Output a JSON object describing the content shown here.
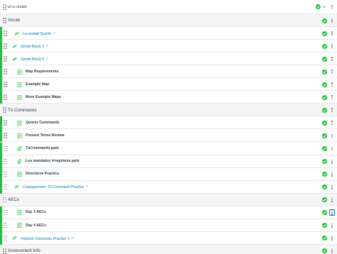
{
  "page": {
    "title": "La ciudad"
  },
  "colors": {
    "published": "#1fc338",
    "link": "#0374b5",
    "text": "#2d3b45",
    "muted": "#6b7780"
  },
  "rows": [
    {
      "kind": "header",
      "title": "Vocab"
    },
    {
      "kind": "item",
      "type": "link",
      "title": "La ciudad Quizlet",
      "external": true
    },
    {
      "kind": "item",
      "type": "link",
      "title": "Gimkit Block 2",
      "external": true
    },
    {
      "kind": "item",
      "type": "link",
      "title": "Gimkit Block 5",
      "external": true
    },
    {
      "kind": "item",
      "type": "page",
      "title": "Map Requirements",
      "external": false
    },
    {
      "kind": "item",
      "type": "page",
      "title": "Example Map",
      "external": false
    },
    {
      "kind": "item",
      "type": "page",
      "title": "More Example Maps",
      "external": false
    },
    {
      "kind": "header",
      "title": "Tú Commands"
    },
    {
      "kind": "item",
      "type": "page",
      "title": "Quizizz Commands",
      "external": false
    },
    {
      "kind": "item",
      "type": "page",
      "title": "Present Tense Review",
      "external": false
    },
    {
      "kind": "item",
      "type": "file",
      "title": "TúCommands.pptx",
      "external": false
    },
    {
      "kind": "item",
      "type": "file",
      "title": "Los mandatos irregulares.pptx",
      "external": false
    },
    {
      "kind": "item",
      "type": "page",
      "title": "Directions Practice",
      "external": false
    },
    {
      "kind": "item",
      "type": "link",
      "title": "Conjuguemos: Tú Command Practice",
      "external": true
    },
    {
      "kind": "header",
      "title": "AECs"
    },
    {
      "kind": "item",
      "type": "page",
      "title": "Day 3 AECs",
      "external": false
    },
    {
      "kind": "item",
      "type": "page",
      "title": "Day 4 AECs",
      "external": false
    },
    {
      "kind": "item",
      "type": "link",
      "title": "FlipGrid: Directions Practice 1",
      "external": true
    },
    {
      "kind": "header",
      "title": "Assessment Info"
    }
  ]
}
